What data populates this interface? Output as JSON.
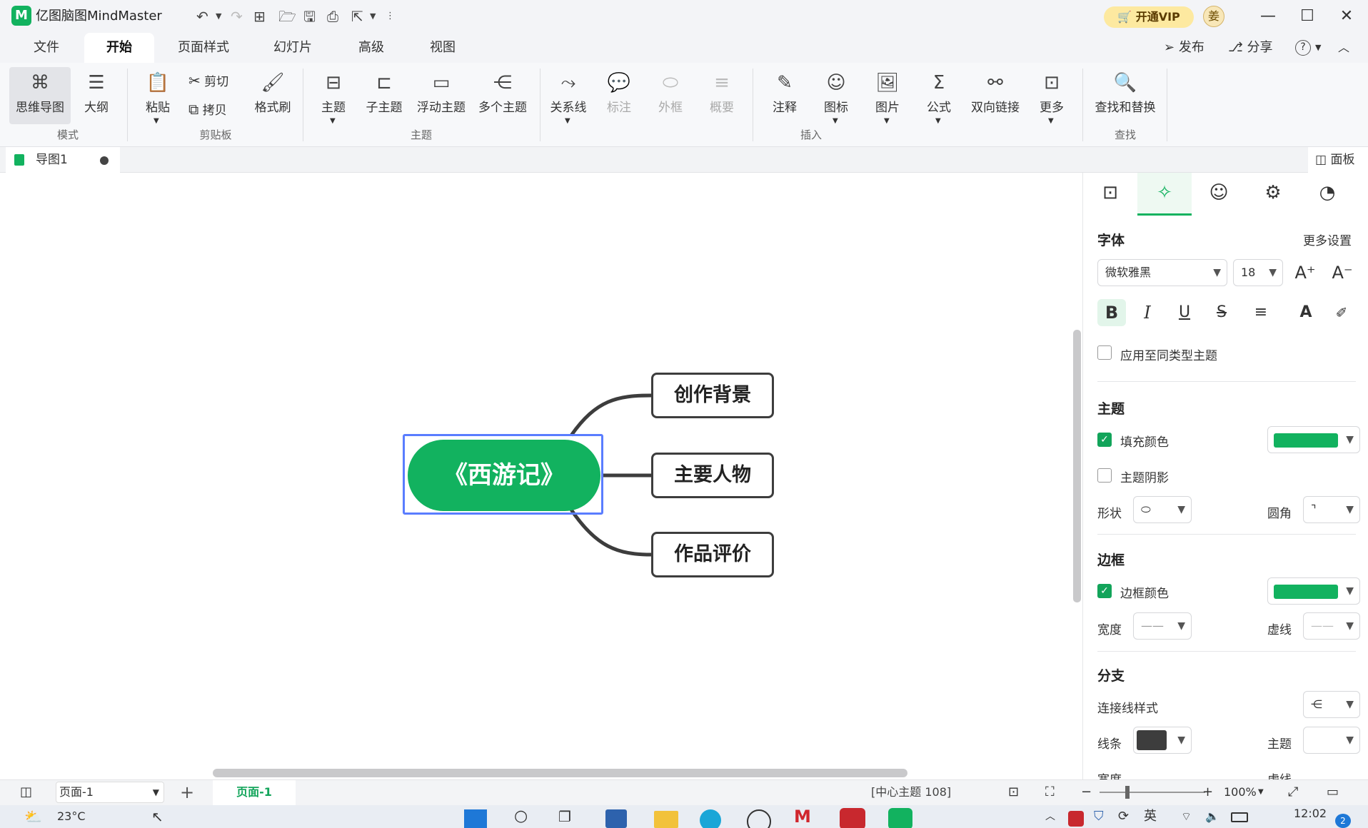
{
  "app": {
    "title": "亿图脑图MindMaster",
    "vip_label": "开通VIP",
    "user_initial": "姜"
  },
  "titlebar_actions": {
    "publish": "发布",
    "share": "分享",
    "help": "?"
  },
  "menu_tabs": [
    "文件",
    "开始",
    "页面样式",
    "幻灯片",
    "高级",
    "视图"
  ],
  "ribbon": {
    "mode": {
      "mindmap": "思维导图",
      "outline": "大纲",
      "group": "模式"
    },
    "clipboard": {
      "paste": "粘贴",
      "cut": "剪切",
      "copy": "拷贝",
      "format_painter": "格式刷",
      "group": "剪贴板"
    },
    "topic": {
      "topic": "主题",
      "subtopic": "子主题",
      "floating": "浮动主题",
      "multiple": "多个主题",
      "group": "主题"
    },
    "insert": {
      "relation": "关系线",
      "callout": "标注",
      "boundary": "外框",
      "summary": "概要",
      "note": "注释",
      "icon": "图标",
      "image": "图片",
      "formula": "公式",
      "bilink": "双向链接",
      "more": "更多",
      "group": "插入"
    },
    "find": {
      "find_replace": "查找和替换",
      "group": "查找"
    }
  },
  "doc_tab": {
    "name": "导图1"
  },
  "panel_toggle": "面板",
  "mindmap": {
    "central": "《西游记》",
    "branches": [
      "创作背景",
      "主要人物",
      "作品评价"
    ]
  },
  "panel": {
    "font": {
      "title": "字体",
      "more": "更多设置",
      "family": "微软雅黑",
      "size": "18",
      "apply_same": "应用至同类型主题"
    },
    "topic": {
      "title": "主题",
      "fill": "填充颜色",
      "shadow": "主题阴影",
      "shape": "形状",
      "corner": "圆角"
    },
    "border": {
      "title": "边框",
      "color": "边框颜色",
      "width": "宽度",
      "dash": "虚线"
    },
    "branch": {
      "title": "分支",
      "connector": "连接线样式",
      "line": "线条",
      "topic": "主题",
      "width": "宽度",
      "dash": "虚线"
    },
    "colors": {
      "fill": "#12b25f",
      "border": "#12b25f",
      "line": "#3d3d3d"
    }
  },
  "pagebar": {
    "page_select": "页面-1",
    "add": "+",
    "page_tab": "页面-1",
    "status": "[中心主题 108]",
    "zoom": "100%"
  },
  "taskbar": {
    "weather": "23°C",
    "lang": "英",
    "time": "12:02",
    "badge": "2"
  }
}
